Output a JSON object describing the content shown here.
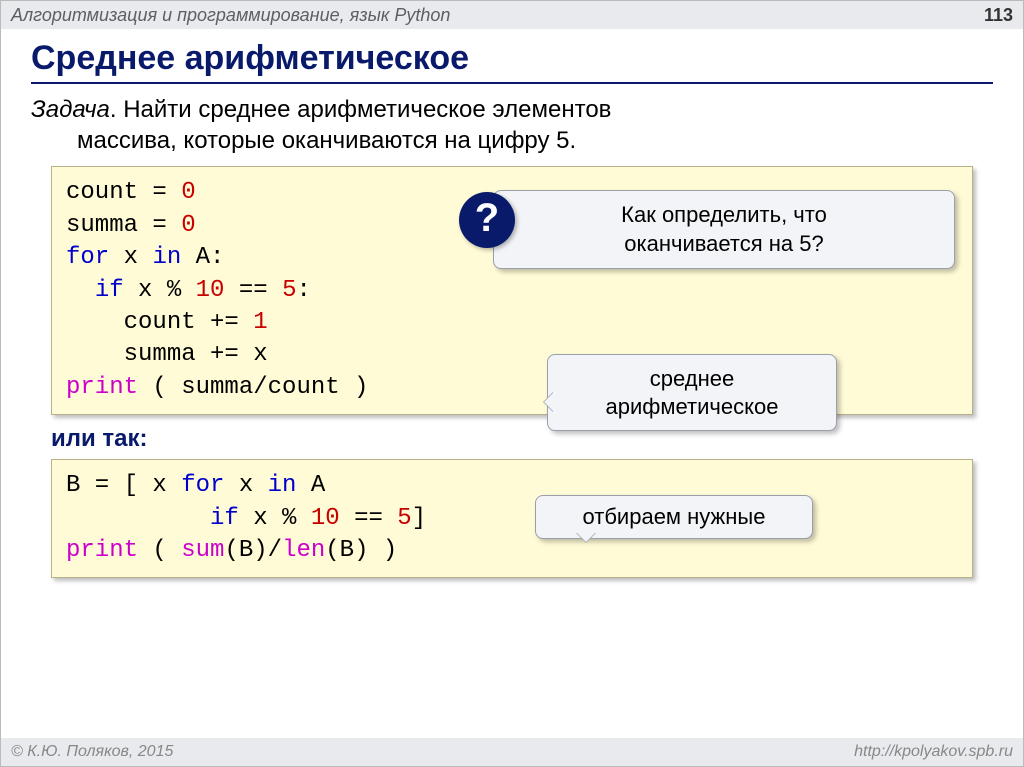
{
  "header": {
    "subject": "Алгоритмизация и программирование, язык Python",
    "page_number": "113"
  },
  "title": "Среднее арифметическое",
  "task": {
    "label": "Задача",
    "text_line1": ". Найти среднее арифметическое элементов",
    "text_line2": "массива, которые оканчиваются на цифру 5."
  },
  "code1": {
    "l1a": "count",
    "l1b": " = ",
    "l1c": "0",
    "l2a": "summa",
    "l2b": " = ",
    "l2c": "0",
    "l3a": "for",
    "l3b": " x ",
    "l3c": "in",
    "l3d": " A:",
    "l4a": "  ",
    "l4b": "if",
    "l4c": " x % ",
    "l4d": "10",
    "l4e": " == ",
    "l4f": "5",
    "l4g": ":",
    "l5a": "    count += ",
    "l5b": "1",
    "l6a": "    summa += x",
    "l7a": "print",
    "l7b": " ( summa/count )"
  },
  "or_label": "или так:",
  "code2": {
    "l1a": "B = [ x ",
    "l1b": "for",
    "l1c": " x ",
    "l1d": "in",
    "l1e": " A",
    "l2a": "          ",
    "l2b": "if",
    "l2c": " x % ",
    "l2d": "10",
    "l2e": " == ",
    "l2f": "5",
    "l2g": "]",
    "l3a": "print",
    "l3b": " ( ",
    "l3c": "sum",
    "l3d": "(B)/",
    "l3e": "len",
    "l3f": "(B) )"
  },
  "callouts": {
    "q_mark": "?",
    "c1_line1": "Как определить, что",
    "c1_line2": "оканчивается на 5?",
    "c2_line1": "среднее",
    "c2_line2": "арифметическое",
    "c3": "отбираем нужные"
  },
  "footer": {
    "left": "© К.Ю. Поляков, 2015",
    "right": "http://kpolyakov.spb.ru"
  }
}
